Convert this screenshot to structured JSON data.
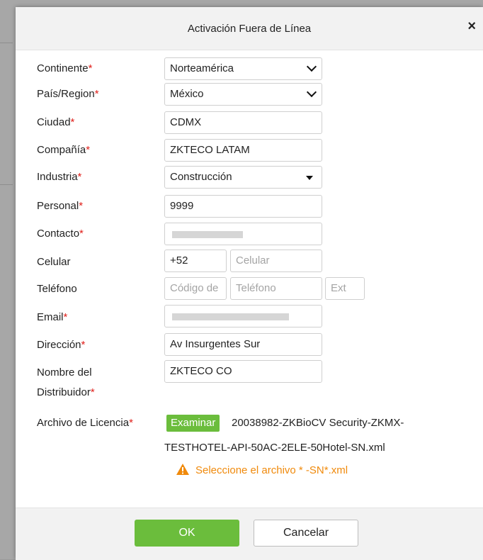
{
  "dialog": {
    "title": "Activación Fuera de Línea",
    "close_symbol": "×"
  },
  "form": {
    "continente": {
      "label": "Continente",
      "required_mark": "*",
      "value": "Norteamérica"
    },
    "pais": {
      "label": "País/Region",
      "required_mark": "*",
      "value": "México"
    },
    "ciudad": {
      "label": "Ciudad",
      "required_mark": "*",
      "value": "CDMX"
    },
    "compania": {
      "label": "Compañía",
      "required_mark": "*",
      "value": "ZKTECO LATAM"
    },
    "industria": {
      "label": "Industria",
      "required_mark": "*",
      "value": "Construcción"
    },
    "personal": {
      "label": "Personal",
      "required_mark": "*",
      "value": "9999"
    },
    "contacto": {
      "label": "Contacto",
      "required_mark": "*",
      "value": ""
    },
    "celular": {
      "label": "Celular",
      "code_value": "+52",
      "number_placeholder": "Celular"
    },
    "telefono": {
      "label": "Teléfono",
      "code_placeholder": "Código de",
      "number_placeholder": "Teléfono",
      "ext_placeholder": "Ext"
    },
    "email": {
      "label": "Email",
      "required_mark": "*",
      "value": ""
    },
    "direccion": {
      "label": "Dirección",
      "required_mark": "*",
      "value": "Av Insurgentes Sur"
    },
    "distribuidor": {
      "label_line1": "Nombre del",
      "label_line2": "Distribuidor",
      "required_mark": "*",
      "value": "ZKTECO CO"
    },
    "licencia": {
      "label": "Archivo de Licencia",
      "required_mark": "*",
      "browse_label": "Examinar",
      "file_name_line1": "20038982-ZKBioCV Security-ZKMX-",
      "file_name_line2": "TESTHOTEL-API-50AC-2ELE-50Hotel-SN.xml",
      "warning": "Seleccione el archivo * -SN*.xml"
    }
  },
  "footer": {
    "ok_label": "OK",
    "cancel_label": "Cancelar"
  },
  "colors": {
    "accent_green": "#6bbd3c",
    "required_red": "#e0201b",
    "warning_orange": "#f08a0c"
  }
}
